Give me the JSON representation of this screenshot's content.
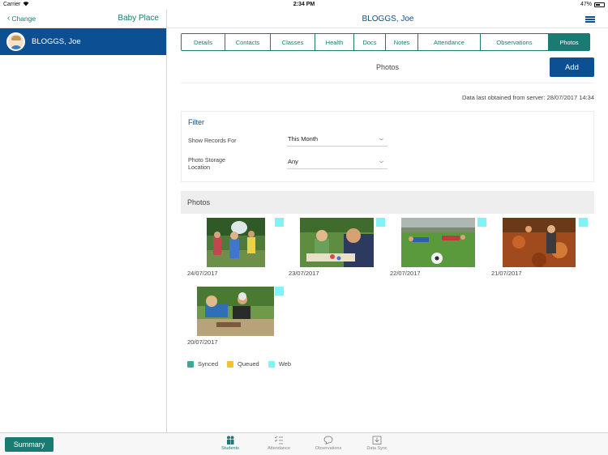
{
  "status_bar": {
    "carrier": "Carrier",
    "time": "2:34 PM",
    "battery": "47%"
  },
  "left_pane": {
    "change_label": "Change",
    "site_name": "Baby Place",
    "students": [
      {
        "name": "BLOGGS, Joe",
        "selected": true
      }
    ]
  },
  "header": {
    "title": "BLOGGS, Joe",
    "menu_icon": "hamburger-menu-icon"
  },
  "tabs": [
    {
      "label": "Details",
      "active": false
    },
    {
      "label": "Contacts",
      "active": false
    },
    {
      "label": "Classes",
      "active": false
    },
    {
      "label": "Health",
      "active": false
    },
    {
      "label": "Docs",
      "active": false
    },
    {
      "label": "Notes",
      "active": false
    },
    {
      "label": "Attendance",
      "active": false
    },
    {
      "label": "Observations",
      "active": false
    },
    {
      "label": "Photos",
      "active": true
    }
  ],
  "section": {
    "title": "Photos",
    "add_label": "Add",
    "last_obtained": "Data last obtained from server: 28/07/2017 14:34"
  },
  "filter": {
    "title": "Filter",
    "records_label": "Show Records For",
    "records_value": "This Month",
    "storage_label_line1": "Photo Storage",
    "storage_label_line2": "Location",
    "storage_value": "Any"
  },
  "photos": {
    "header": "Photos",
    "items": [
      {
        "date": "24/07/2017",
        "status": "Web"
      },
      {
        "date": "23/07/2017",
        "status": "Web"
      },
      {
        "date": "22/07/2017",
        "status": "Web"
      },
      {
        "date": "21/07/2017",
        "status": "Web"
      },
      {
        "date": "20/07/2017",
        "status": "Web"
      }
    ]
  },
  "legend": [
    {
      "label": "Synced",
      "color": "#3aa99a"
    },
    {
      "label": "Queued",
      "color": "#f1c232"
    },
    {
      "label": "Web",
      "color": "#7ff3f7"
    }
  ],
  "bottom_bar": {
    "summary_label": "Summary",
    "items": [
      {
        "label": "Students",
        "icon": "students-icon",
        "active": true
      },
      {
        "label": "Attendance",
        "icon": "attendance-icon",
        "active": false
      },
      {
        "label": "Observations",
        "icon": "observations-icon",
        "active": false
      },
      {
        "label": "Data Sync",
        "icon": "data-sync-icon",
        "active": false
      }
    ]
  },
  "colors": {
    "primary_blue": "#0c4f92",
    "teal": "#1a7b72",
    "web_marker": "#7ff3f7"
  }
}
